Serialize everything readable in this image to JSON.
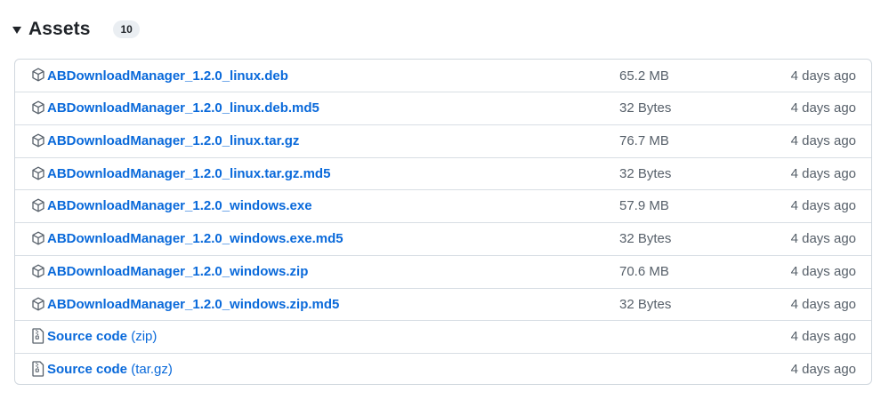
{
  "header": {
    "title": "Assets",
    "count": "10"
  },
  "assets": [
    {
      "name": "ABDownloadManager_1.2.0_linux.deb",
      "size": "65.2 MB",
      "date": "4 days ago",
      "icon": "package-icon"
    },
    {
      "name": "ABDownloadManager_1.2.0_linux.deb.md5",
      "size": "32 Bytes",
      "date": "4 days ago",
      "icon": "package-icon"
    },
    {
      "name": "ABDownloadManager_1.2.0_linux.tar.gz",
      "size": "76.7 MB",
      "date": "4 days ago",
      "icon": "package-icon"
    },
    {
      "name": "ABDownloadManager_1.2.0_linux.tar.gz.md5",
      "size": "32 Bytes",
      "date": "4 days ago",
      "icon": "package-icon"
    },
    {
      "name": "ABDownloadManager_1.2.0_windows.exe",
      "size": "57.9 MB",
      "date": "4 days ago",
      "icon": "package-icon"
    },
    {
      "name": "ABDownloadManager_1.2.0_windows.exe.md5",
      "size": "32 Bytes",
      "date": "4 days ago",
      "icon": "package-icon"
    },
    {
      "name": "ABDownloadManager_1.2.0_windows.zip",
      "size": "70.6 MB",
      "date": "4 days ago",
      "icon": "package-icon"
    },
    {
      "name": "ABDownloadManager_1.2.0_windows.zip.md5",
      "size": "32 Bytes",
      "date": "4 days ago",
      "icon": "package-icon"
    }
  ],
  "source_code": [
    {
      "name": "Source code",
      "suffix": "(zip)",
      "date": "4 days ago",
      "icon": "file-zip-icon"
    },
    {
      "name": "Source code",
      "suffix": "(tar.gz)",
      "date": "4 days ago",
      "icon": "file-zip-icon"
    }
  ],
  "colors": {
    "link": "#0969da",
    "muted": "#57606a",
    "border": "#d0d7de",
    "badge_bg": "#eaeef2"
  }
}
